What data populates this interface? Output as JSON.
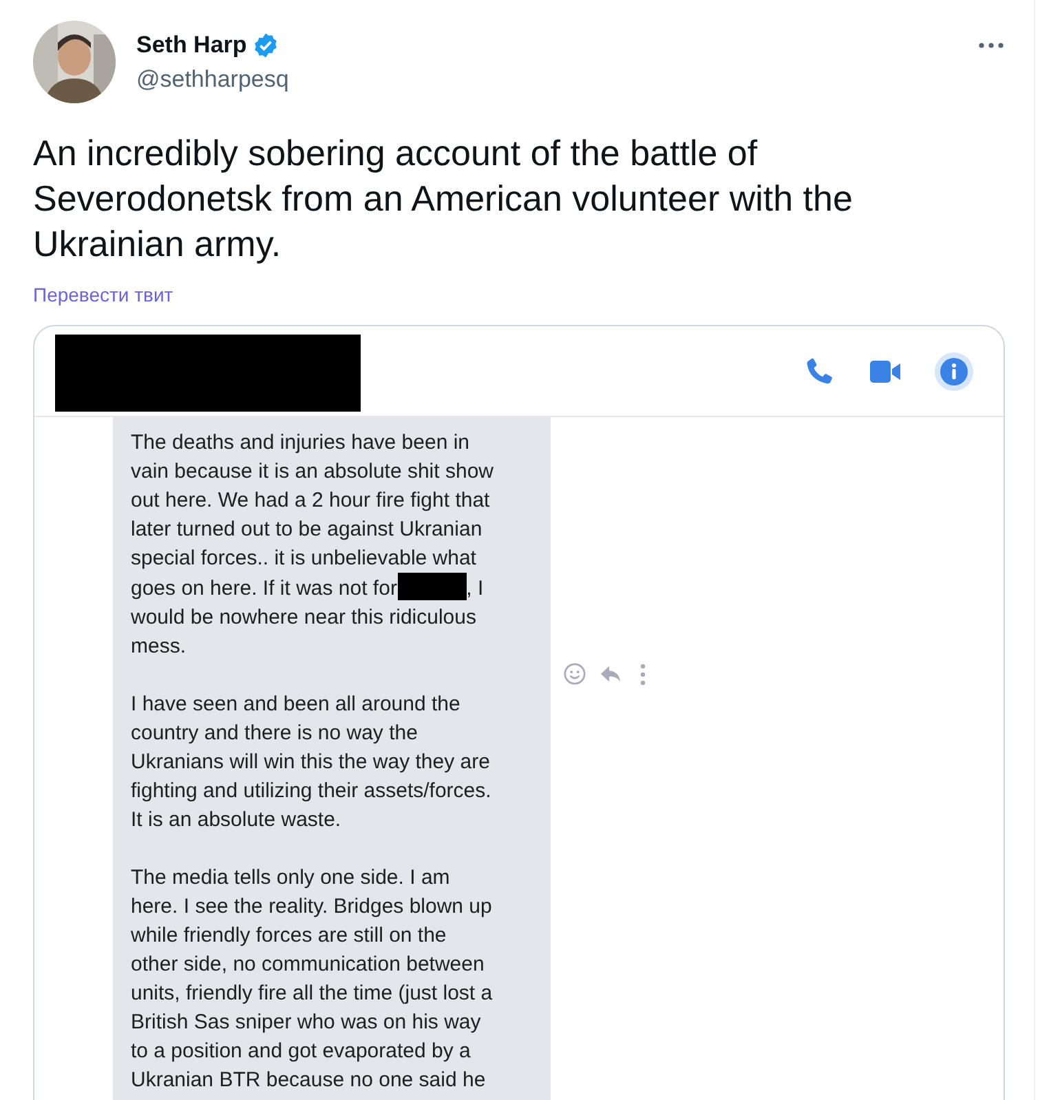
{
  "author": {
    "name": "Seth Harp",
    "verified": true,
    "handle": "@sethharpesq"
  },
  "tweet": {
    "lines": [
      "An incredibly sobering account of the battle of",
      "Severodonetsk from an American volunteer with the",
      "Ukrainian army."
    ]
  },
  "translate_link": "Перевести твит",
  "media": {
    "header": {
      "name_redacted": true
    },
    "message": {
      "paragraphs": [
        {
          "lines": [
            {
              "kind": "text",
              "text": "The deaths and injuries have been in"
            },
            {
              "kind": "text",
              "text": "vain because it is an absolute shit show"
            },
            {
              "kind": "text",
              "text": "out here. We had a 2 hour fire fight that"
            },
            {
              "kind": "text",
              "text": "later turned out to be against Ukranian"
            },
            {
              "kind": "text",
              "text": "special forces.. it is unbelievable what"
            },
            {
              "kind": "redacted",
              "before": "goes on here. If it was not for",
              "after": ", I"
            },
            {
              "kind": "text",
              "text": "would be nowhere near this ridiculous"
            },
            {
              "kind": "text",
              "text": "mess."
            }
          ]
        },
        {
          "lines": [
            {
              "kind": "text",
              "text": "I have seen and been all around the"
            },
            {
              "kind": "text",
              "text": "country and there is no way the"
            },
            {
              "kind": "text",
              "text": "Ukranians will win this the way they are"
            },
            {
              "kind": "text",
              "text": "fighting and utilizing their assets/forces."
            },
            {
              "kind": "text",
              "text": "It is an absolute waste."
            }
          ]
        },
        {
          "lines": [
            {
              "kind": "text",
              "text": "The media tells only one side. I am"
            },
            {
              "kind": "text",
              "text": "here. I see the reality. Bridges blown up"
            },
            {
              "kind": "text",
              "text": "while friendly forces are still on the"
            },
            {
              "kind": "text",
              "text": "other side, no communication between"
            },
            {
              "kind": "text",
              "text": "units, friendly fire all the time (just lost a"
            },
            {
              "kind": "text",
              "text": "British Sas sniper who was on his way"
            },
            {
              "kind": "text",
              "text": "to a position and got evaporated by a"
            },
            {
              "kind": "text",
              "text": "Ukranian BTR because no one said he"
            }
          ]
        }
      ]
    }
  }
}
